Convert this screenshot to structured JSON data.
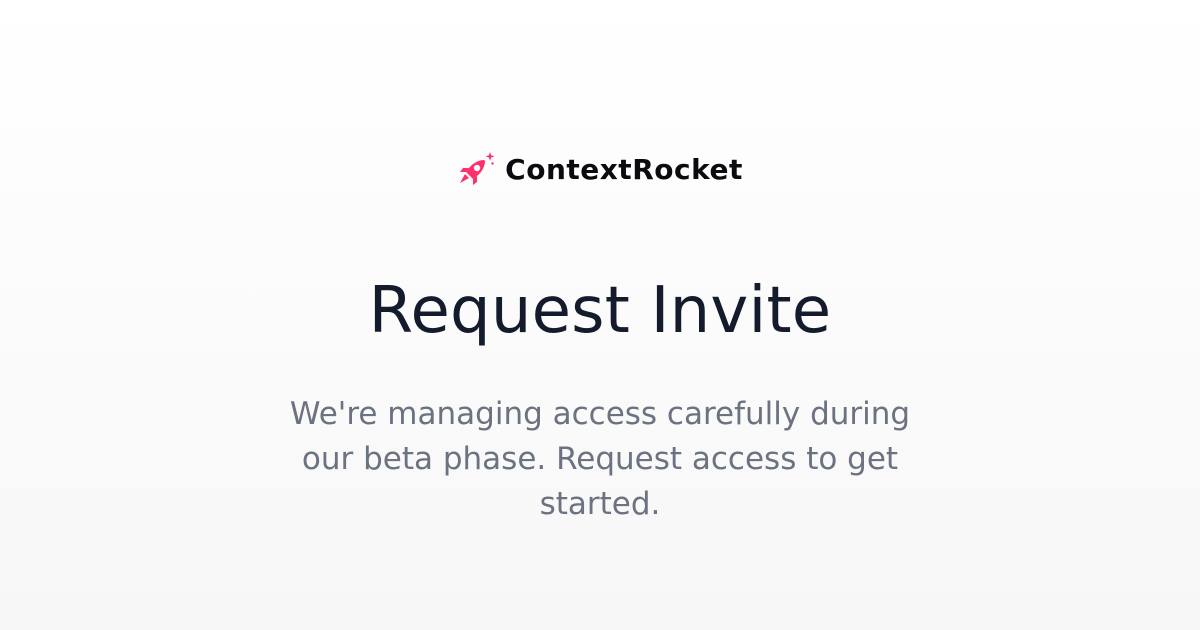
{
  "brand": {
    "name": "ContextRocket",
    "logo_icon": "rocket-icon",
    "accent_color": "#ff2f6d"
  },
  "hero": {
    "title": "Request Invite",
    "subtitle": "We're managing access carefully during our beta phase. Request access to get started."
  },
  "colors": {
    "title": "#141b2d",
    "subtitle": "#6b7280",
    "background": "#f7f7f8"
  }
}
